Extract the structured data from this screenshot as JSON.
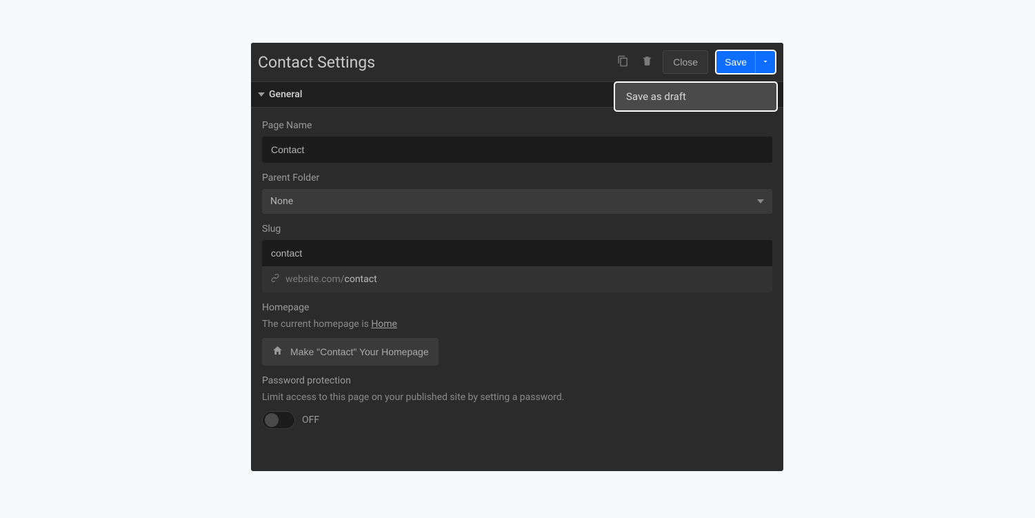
{
  "header": {
    "title": "Contact Settings",
    "close_label": "Close",
    "save_label": "Save"
  },
  "dropdown": {
    "save_as_draft": "Save as draft"
  },
  "sections": {
    "general": {
      "title": "General"
    }
  },
  "fields": {
    "page_name": {
      "label": "Page Name",
      "value": "Contact"
    },
    "parent_folder": {
      "label": "Parent Folder",
      "value": "None"
    },
    "slug": {
      "label": "Slug",
      "value": "contact",
      "preview_prefix": "website.com/",
      "preview_slug": "contact"
    },
    "homepage": {
      "label": "Homepage",
      "subtext_prefix": "The current homepage is ",
      "current_home": "Home",
      "button_label": "Make \"Contact\" Your Homepage"
    },
    "password": {
      "label": "Password protection",
      "subtext": "Limit access to this page on your published site by setting a password.",
      "state_label": "OFF"
    }
  }
}
